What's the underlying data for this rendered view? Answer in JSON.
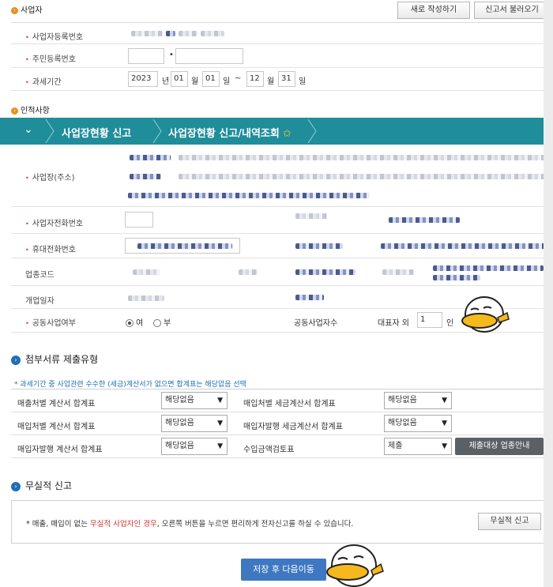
{
  "section_business": {
    "title": "사업자",
    "btn_new": "새로 작성하기",
    "btn_load": "신고서 불러오기"
  },
  "biz_fields": {
    "reg_no_label": "사업자등록번호",
    "resident_no_label": "주민등록번호",
    "tax_period_label": "과세기간",
    "period": {
      "year": "2023",
      "year_unit": "년",
      "from_month": "01",
      "month_unit": "월",
      "from_day": "01",
      "day_unit": "일",
      "tilde": "~",
      "to_month": "12",
      "to_day": "31"
    }
  },
  "section_personal": {
    "title": "인적사항"
  },
  "navbar": {
    "item1": "사업장현황 신고",
    "item2": "사업장현황 신고/내역조회",
    "chevron": "chevron-down-icon",
    "star": "star-icon"
  },
  "personal_fields": {
    "address_label": "사업장(주소)",
    "biz_phone_label": "사업자전화번호",
    "mobile_label": "휴대전화번호",
    "industry_code_label": "업종코드",
    "open_date_label": "개업일자",
    "joint_label": "공동사업여부",
    "joint_yes": "여",
    "joint_no": "부",
    "joint_count_label": "공동사업자수",
    "rep_prefix": "대표자 외",
    "rep_count": "1",
    "rep_suffix": "인"
  },
  "attachments": {
    "title": "첨부서류 제출유형",
    "note": "* 과세기간 중 사업관련 수수한 (세금)계산서가 없으면 합계표는 해당없음 선택",
    "rows": [
      {
        "left_label": "매출처별 계산서 합계표",
        "left_value": "해당없음",
        "right_label": "매입처별 세금계산서 합계표",
        "right_value": "해당없음"
      },
      {
        "left_label": "매입처별 계산서 합계표",
        "left_value": "해당없음",
        "right_label": "매입자발행 세금계산서 합계표",
        "right_value": "해당없음"
      },
      {
        "left_label": "매입자발행 계산서 합계표",
        "left_value": "해당없음",
        "right_label": "수입금액검토표",
        "right_value": "제출"
      }
    ],
    "guide_btn": "제출대상 업종안내"
  },
  "no_activity": {
    "title": "무실적 신고",
    "msg_before": "* 매출, 매입이 없는 ",
    "msg_red": "무실적 사업자인 경우",
    "msg_after": ", 오른쪽 버튼을 누르면 편리하게 전자신고를 하실 수 있습니다.",
    "btn": "무실적 신고"
  },
  "footer": {
    "save_next": "저장 후 다음이동"
  },
  "colors": {
    "teal": "#1f8d9a",
    "orange": "#e8901d",
    "blue": "#1e6fb8",
    "red": "#d33333",
    "button_blue": "#3f78c2"
  }
}
